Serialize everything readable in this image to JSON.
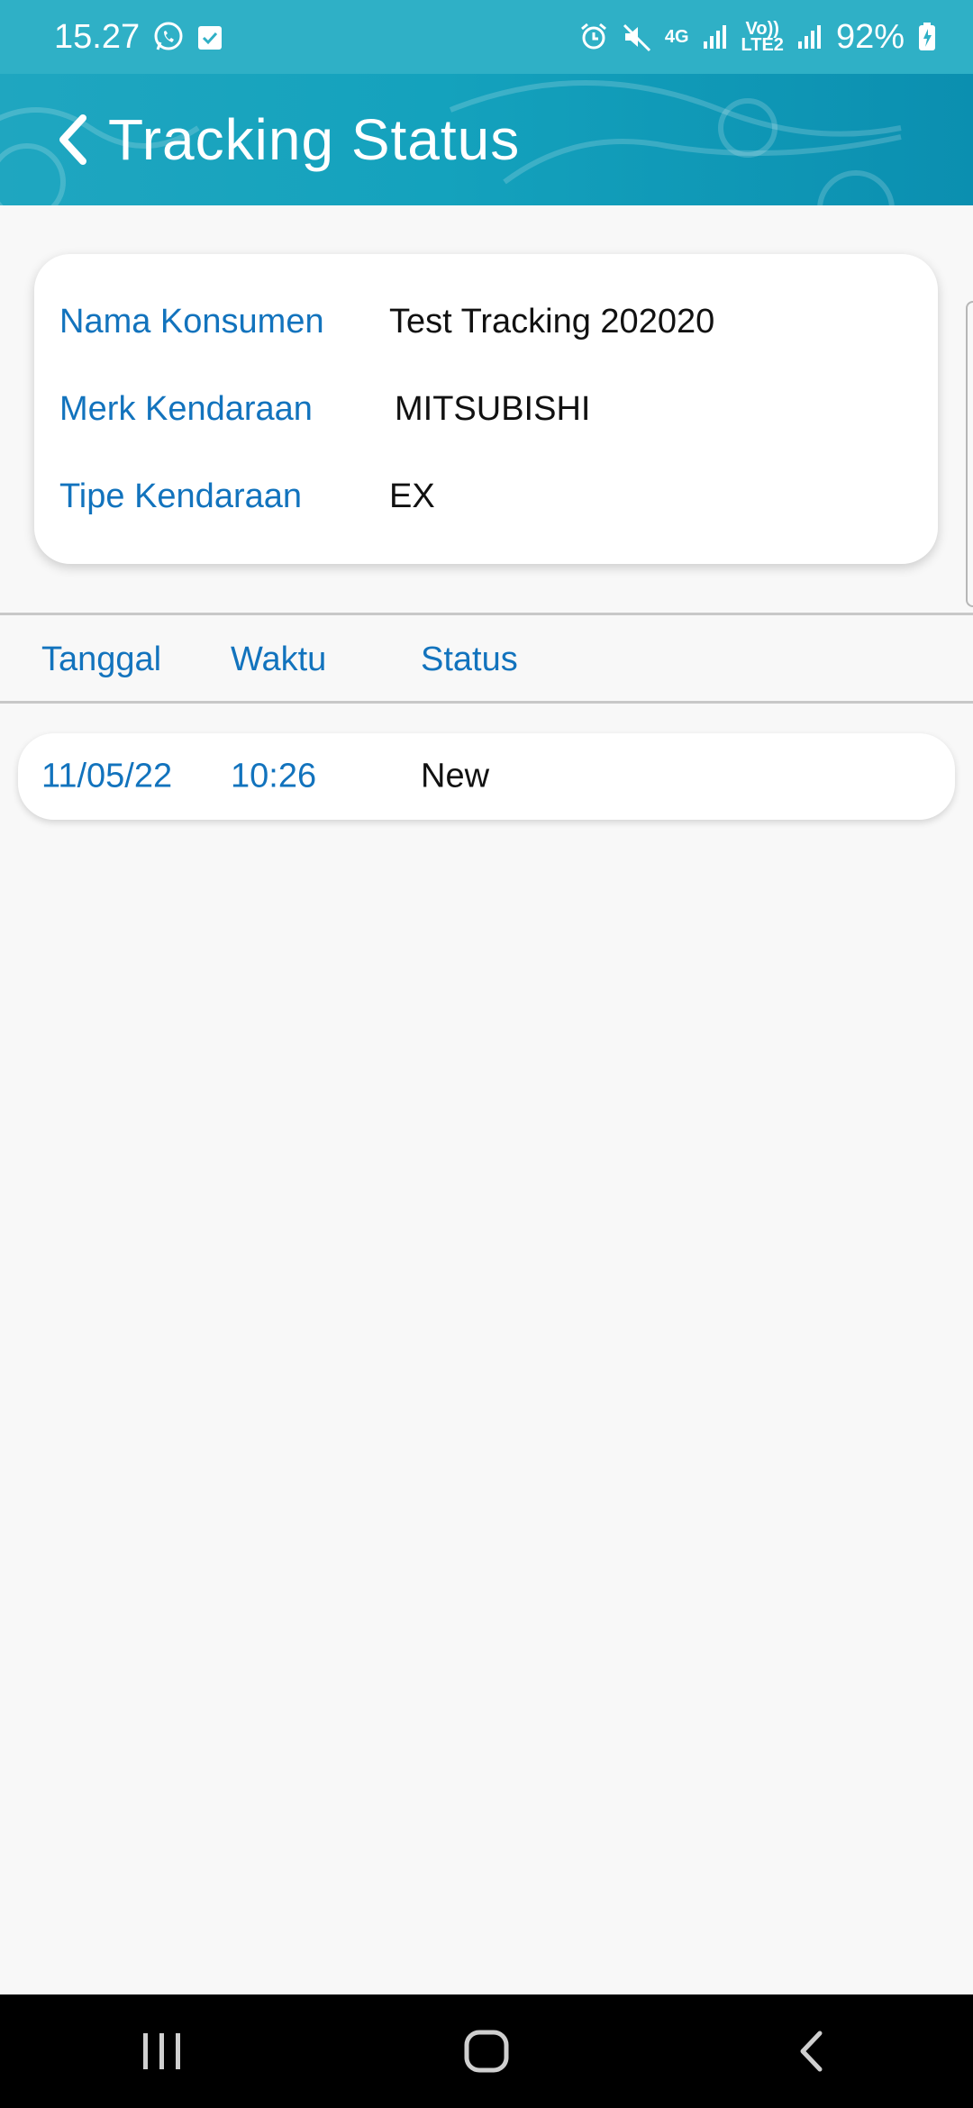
{
  "status_bar": {
    "time": "15.27",
    "network": "4G",
    "volte": "Vo))",
    "lte": "LTE2",
    "battery": "92%"
  },
  "app_bar": {
    "title": "Tracking Status"
  },
  "info": {
    "rows": [
      {
        "label": "Nama Konsumen",
        "value": "Test Tracking 202020"
      },
      {
        "label": "Merk Kendaraan",
        "value": "MITSUBISHI"
      },
      {
        "label": "Tipe Kendaraan",
        "value": "EX"
      }
    ]
  },
  "table": {
    "headers": {
      "date": "Tanggal",
      "time": "Waktu",
      "status": "Status"
    },
    "rows": [
      {
        "date": "11/05/22",
        "time": "10:26",
        "status": "New"
      }
    ]
  },
  "colors": {
    "header_bg": "#14a2bd",
    "accent_text": "#1273bd",
    "background": "#f8f8f8"
  }
}
